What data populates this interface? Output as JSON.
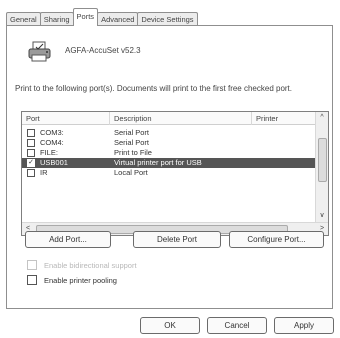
{
  "tabs": [
    "General",
    "Sharing",
    "Ports",
    "Advanced",
    "Device Settings"
  ],
  "active_tab": "Ports",
  "printer_name": "AGFA-AccuSet v52.3",
  "instruction": "Print to the following port(s). Documents will print to the first free checked port.",
  "columns": [
    "Port",
    "Description",
    "Printer"
  ],
  "ports": [
    {
      "port": "COM3:",
      "description": "Serial Port",
      "checked": false,
      "selected": false
    },
    {
      "port": "COM4:",
      "description": "Serial Port",
      "checked": false,
      "selected": false
    },
    {
      "port": "FILE:",
      "description": "Print to File",
      "checked": false,
      "selected": false
    },
    {
      "port": "USB001",
      "description": "Virtual printer port for USB",
      "checked": true,
      "selected": true
    },
    {
      "port": "IR",
      "description": "Local Port",
      "checked": false,
      "selected": false
    }
  ],
  "buttons": {
    "add_port": "Add Port...",
    "delete_port": "Delete Port",
    "configure_port": "Configure Port...",
    "ok": "OK",
    "cancel": "Cancel",
    "apply": "Apply"
  },
  "options": {
    "bidirectional": {
      "label": "Enable bidirectional support",
      "checked": false,
      "enabled": false
    },
    "pooling": {
      "label": "Enable printer pooling",
      "checked": false,
      "enabled": true
    }
  },
  "icons": {
    "printer": "printer-icon",
    "scroll_up": "chevron-up-icon",
    "scroll_down": "chevron-down-icon",
    "scroll_left": "chevron-left-icon",
    "scroll_right": "chevron-right-icon"
  },
  "colors": {
    "selected_row": "#555555"
  }
}
